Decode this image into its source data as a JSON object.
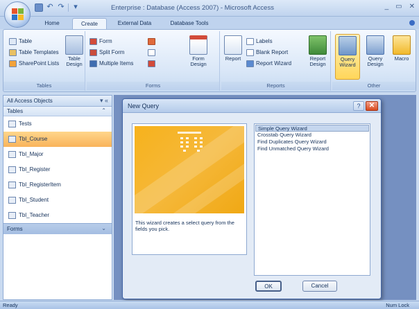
{
  "window": {
    "title": "Enterprise : Database (Access 2007) - Microsoft Access",
    "controls": [
      "_",
      "▭",
      "✕"
    ]
  },
  "tabs": [
    "Home",
    "Create",
    "External Data",
    "Database Tools"
  ],
  "ribbon": {
    "tables": {
      "label": "Tables",
      "small": [
        "Table",
        "Table Templates",
        "SharePoint Lists"
      ],
      "big_label": "Table Design"
    },
    "forms": {
      "label": "Forms",
      "small": [
        "Form",
        "Split Form",
        "Multiple Items"
      ],
      "big_label": "Form Design"
    },
    "reports": {
      "label": "Reports",
      "report_label": "Report",
      "small": [
        "Labels",
        "Blank Report",
        "Report Wizard"
      ],
      "big_label": "Report Design"
    },
    "other": {
      "label": "Other",
      "query_wizard": "Query Wizard",
      "query_design": "Query Design",
      "macro": "Macro"
    }
  },
  "nav": {
    "header": "All Access Objects",
    "group_tables": "Tables",
    "items": [
      "Tests",
      "Tbl_Course",
      "Tbl_Major",
      "Tbl_Register",
      "Tbl_RegisterItem",
      "Tbl_Student",
      "Tbl_Teacher"
    ],
    "selected_index": 1,
    "group_forms": "Forms"
  },
  "dialog": {
    "title": "New Query",
    "description": "This wizard creates a select query from the fields you pick.",
    "options": [
      "Simple Query Wizard",
      "Crosstab Query Wizard",
      "Find Duplicates Query Wizard",
      "Find Unmatched Query Wizard"
    ],
    "selected_index": 0,
    "ok_label": "OK",
    "cancel_label": "Cancel"
  },
  "status": {
    "left": "Ready",
    "right": "Num Lock"
  }
}
